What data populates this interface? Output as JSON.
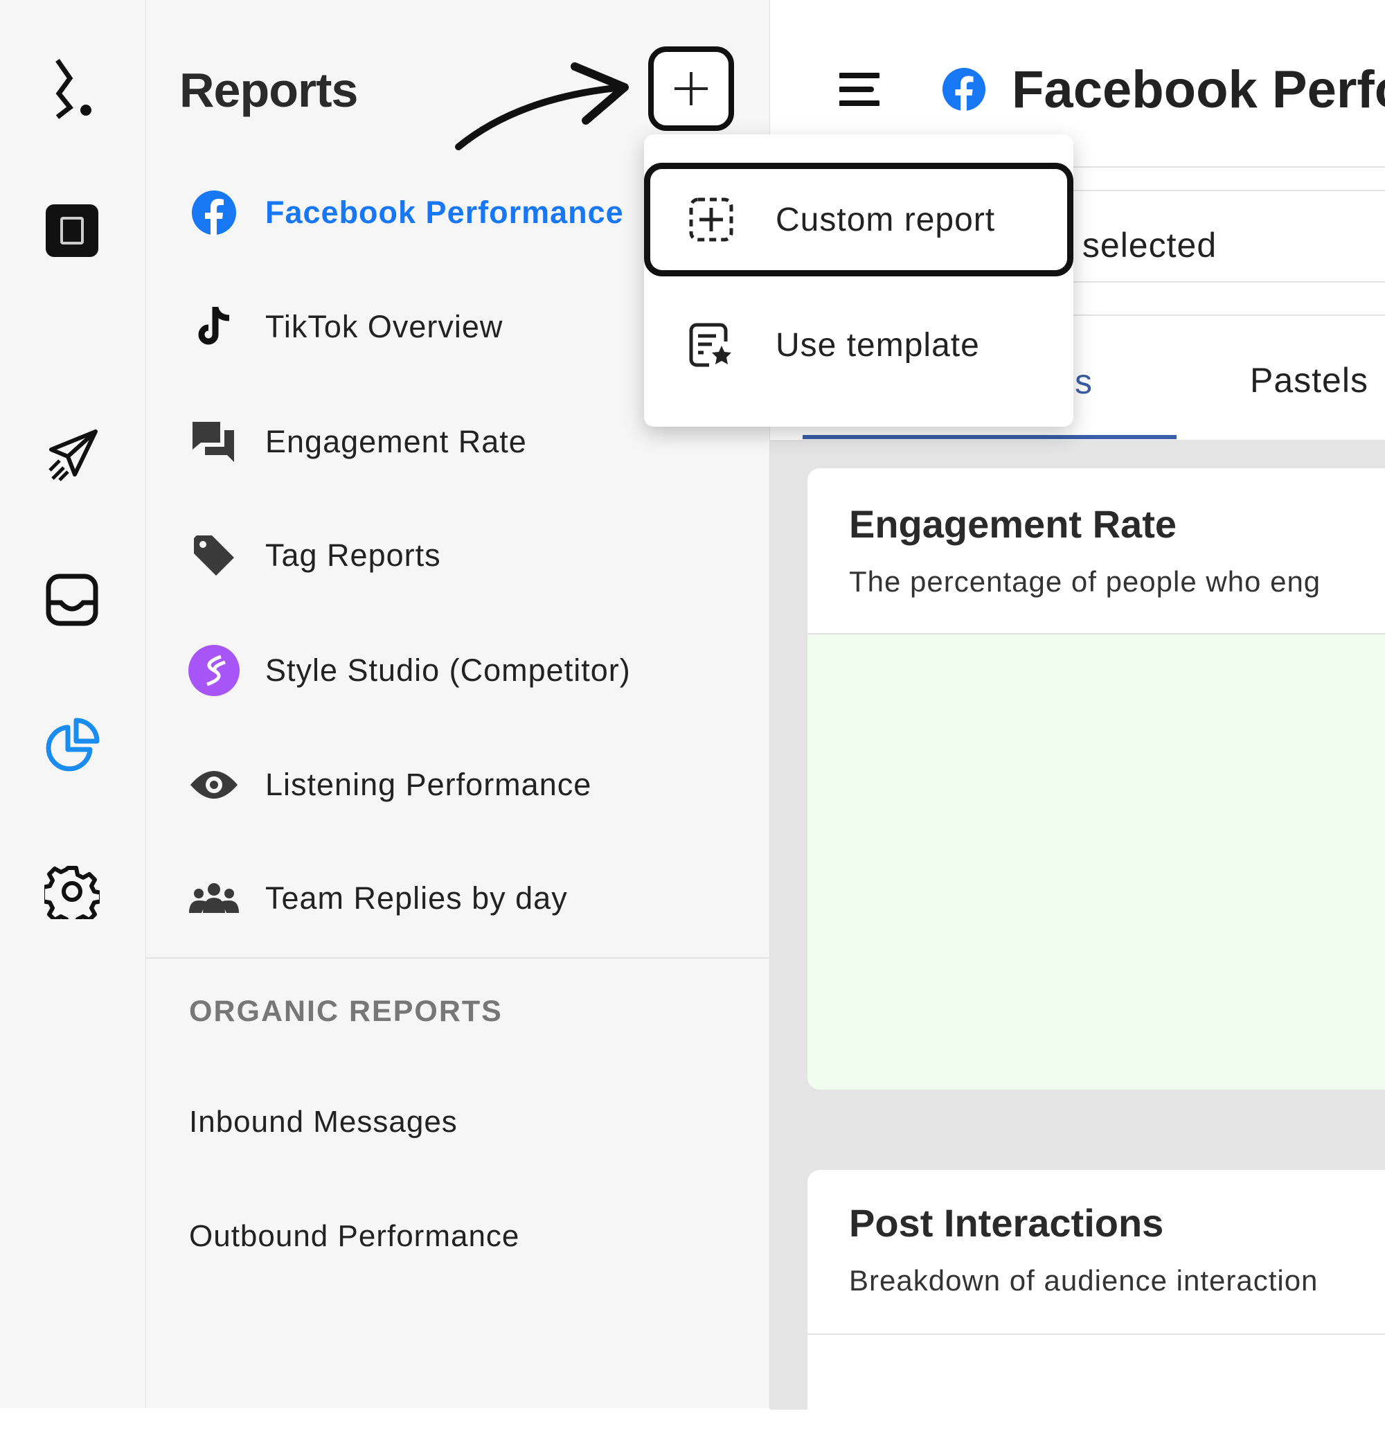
{
  "sidebar": {
    "title": "Reports",
    "items": [
      {
        "label": "Facebook Performance",
        "icon": "facebook-icon",
        "active": true
      },
      {
        "label": "TikTok Overview",
        "icon": "tiktok-icon"
      },
      {
        "label": "Engagement Rate",
        "icon": "chat-bubbles-icon"
      },
      {
        "label": "Tag Reports",
        "icon": "tag-icon"
      },
      {
        "label": "Style Studio (Competitor)",
        "icon": "style-studio-logo-icon"
      },
      {
        "label": "Listening Performance",
        "icon": "eye-icon"
      },
      {
        "label": "Team Replies by day",
        "icon": "team-icon"
      }
    ],
    "section_heading": "ORGANIC REPORTS",
    "section_items": [
      "Inbound Messages",
      "Outbound Performance"
    ]
  },
  "dropdown": {
    "items": [
      {
        "label": "Custom report",
        "icon": "dashed-plus-icon"
      },
      {
        "label": "Use template",
        "icon": "template-star-icon"
      }
    ]
  },
  "main": {
    "title": "Facebook Perfo",
    "filter_text": "s selected",
    "tabs": [
      "s",
      "Pastels"
    ],
    "cards": [
      {
        "title": "Engagement Rate",
        "subtitle": "The percentage of people who eng"
      },
      {
        "title": "Post Interactions",
        "subtitle": "Breakdown of audience interaction"
      }
    ]
  },
  "colors": {
    "accent": "#1877f2",
    "tab_underline": "#3a5ea8",
    "chart_bg": "#f1fdee",
    "style_studio": "#a855f7"
  }
}
